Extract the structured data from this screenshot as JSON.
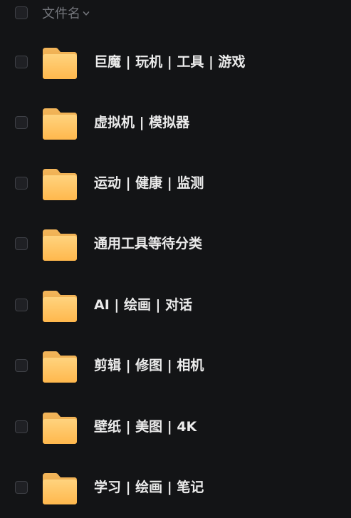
{
  "header": {
    "column_label": "文件名",
    "sort_icon": "chevron-down-icon"
  },
  "folder_icon": "folder-icon",
  "colors": {
    "background": "#131416",
    "folder_light": "#FFD37E",
    "folder_dark": "#FFB84D",
    "text": "#EBEBEB",
    "header_text": "#74767C"
  },
  "folders": [
    {
      "name": "巨魔 | 玩机 | 工具 | 游戏"
    },
    {
      "name": "虚拟机 | 模拟器"
    },
    {
      "name": "运动 | 健康 | 监测"
    },
    {
      "name": "通用工具等待分类"
    },
    {
      "name": "AI | 绘画 | 对话"
    },
    {
      "name": "剪辑 | 修图 | 相机"
    },
    {
      "name": "壁纸 | 美图 | 4K"
    },
    {
      "name": "学习 | 绘画 | 笔记"
    }
  ]
}
